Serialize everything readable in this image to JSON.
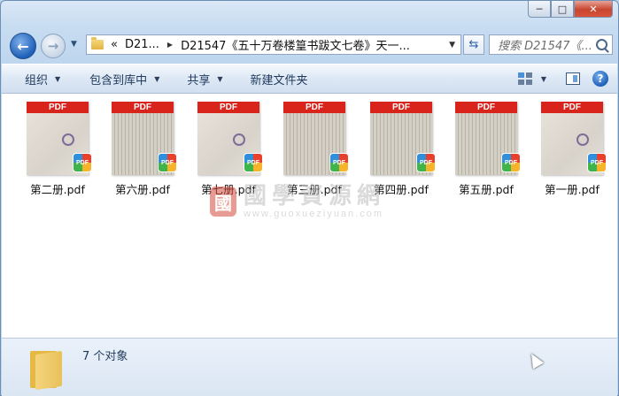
{
  "window": {
    "caption": {
      "minimize": "─",
      "maximize": "□",
      "close": "✕"
    }
  },
  "nav": {
    "back_icon": "back-arrow-icon",
    "forward_icon": "forward-arrow-icon",
    "breadcrumb": [
      "D21...",
      "D21547《五十万卷楼篁书跋文七卷》天一..."
    ],
    "prefix": "«",
    "search_placeholder": "搜索 D21547《..."
  },
  "toolbar": {
    "organize": "组织",
    "include_library": "包含到库中",
    "share": "共享",
    "new_folder": "新建文件夹"
  },
  "files": [
    {
      "name": "第二册.pdf",
      "thumb": "pale"
    },
    {
      "name": "第六册.pdf",
      "thumb": "text"
    },
    {
      "name": "第七册.pdf",
      "thumb": "pale"
    },
    {
      "name": "第三册.pdf",
      "thumb": "text"
    },
    {
      "name": "第四册.pdf",
      "thumb": "text"
    },
    {
      "name": "第五册.pdf",
      "thumb": "text"
    },
    {
      "name": "第一册.pdf",
      "thumb": "pale"
    }
  ],
  "pdf_label": "PDF",
  "badge_label": "PDF",
  "watermark": {
    "seal": "國",
    "cn": "國學資源網",
    "url": "www.guoxueziyuan.com"
  },
  "status": {
    "count": "7 个对象"
  }
}
